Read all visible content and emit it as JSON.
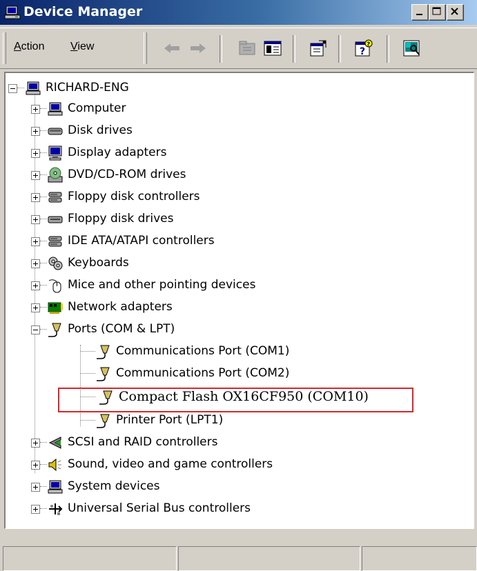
{
  "window": {
    "title": "Device Manager"
  },
  "menu": {
    "action": "Action",
    "view": "View"
  },
  "tree": {
    "root": "RICHARD-ENG",
    "categories": [
      {
        "label": "Computer",
        "icon": "computer-icon"
      },
      {
        "label": "Disk drives",
        "icon": "disk-drive-icon"
      },
      {
        "label": "Display adapters",
        "icon": "monitor-icon"
      },
      {
        "label": "DVD/CD-ROM drives",
        "icon": "cdrom-icon"
      },
      {
        "label": "Floppy disk controllers",
        "icon": "controller-icon"
      },
      {
        "label": "Floppy disk drives",
        "icon": "floppy-drive-icon"
      },
      {
        "label": "IDE ATA/ATAPI controllers",
        "icon": "controller-icon"
      },
      {
        "label": "Keyboards",
        "icon": "keyboard-icon"
      },
      {
        "label": "Mice and other pointing devices",
        "icon": "mouse-icon"
      },
      {
        "label": "Network adapters",
        "icon": "network-card-icon"
      },
      {
        "label": "Ports (COM & LPT)",
        "icon": "port-connector-icon"
      }
    ],
    "ports": [
      "Communications Port (COM1)",
      "Communications Port (COM2)",
      "Compact Flash OX16CF950 (COM10)",
      "Printer Port (LPT1)"
    ],
    "more_categories": [
      {
        "label": "SCSI and RAID controllers",
        "icon": "scsi-icon"
      },
      {
        "label": "Sound, video and game controllers",
        "icon": "speaker-icon"
      },
      {
        "label": "System devices",
        "icon": "computer-icon"
      },
      {
        "label": "Universal Serial Bus controllers",
        "icon": "usb-icon"
      }
    ]
  },
  "colors": {
    "title_start": "#0a246a",
    "title_end": "#a6caf0",
    "highlight_box": "#d9262b",
    "face": "#d4d0c8"
  }
}
